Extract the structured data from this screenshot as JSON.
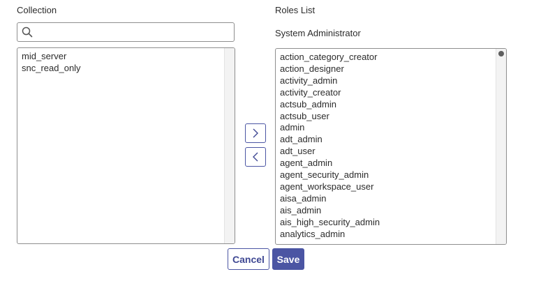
{
  "collection": {
    "title": "Collection",
    "search_placeholder": "",
    "items": [
      "mid_server",
      "snc_read_only"
    ]
  },
  "roles": {
    "title": "Roles List",
    "subtitle": "System Administrator",
    "items": [
      "action_category_creator",
      "action_designer",
      "activity_admin",
      "activity_creator",
      "actsub_admin",
      "actsub_user",
      "admin",
      "adt_admin",
      "adt_user",
      "agent_admin",
      "agent_security_admin",
      "agent_workspace_user",
      "aisa_admin",
      "ais_admin",
      "ais_high_security_admin",
      "analytics_admin"
    ]
  },
  "actions": {
    "move_right_icon": "chevron-right-icon",
    "move_left_icon": "chevron-left-icon",
    "cancel_label": "Cancel",
    "save_label": "Save"
  },
  "colors": {
    "accent": "#4b55a3",
    "border": "#8e8e8e"
  }
}
